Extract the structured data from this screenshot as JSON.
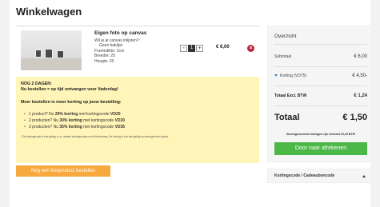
{
  "page": {
    "title": "Winkelwagen"
  },
  "cart": {
    "item": {
      "name": "Eigen foto op canvas",
      "details": [
        "Wil je je canvas inlijsten?:",
        "Geen baklijst",
        "Framedikte:   2cm",
        "Breedte:   20",
        "Hoogte:   20"
      ],
      "quantity": "1",
      "minus": "-",
      "plus": "+",
      "price": "€ 6,00",
      "remove_glyph": "×"
    },
    "promo": {
      "line1": "NOG 2 DAGEN:",
      "line2": "Nu bestellen = op tijd ontvangen voor Vaderdag!",
      "heading": "Meer bestellen is meer korting op jouw bestelling:",
      "tiers": [
        {
          "pre": "1 product? Nu ",
          "discount": "20% korting",
          "mid": " met kortingscode ",
          "code": "VD20"
        },
        {
          "pre": "2 producten? Nu ",
          "discount": "30% korting",
          "mid": " met kortingscode ",
          "code": "VD30"
        },
        {
          "pre": "3 producten? Nu ",
          "discount": "35% korting",
          "mid": " met kortingscode ",
          "code": "VD35"
        }
      ],
      "fineprint": "* De kortingscode is niet geldig i.c.m. andere kortingscodes en/of fotobehang. De korting is ook niet geldig op extra gekozen opties."
    },
    "secondary_button": "Nog een fotoproduct bestellen"
  },
  "summary": {
    "heading": "Overzicht",
    "subtotal_label": "Subtotaal",
    "subtotal_value": "€ 6,00",
    "discount_label": "Korting (VD75)",
    "discount_value": "€ 4,50-",
    "excl_label": "Totaal Excl. BTW",
    "excl_value": "€ 1,24",
    "total_label": "Totaal",
    "total_value": "€ 1,50",
    "shipping_note": "Bovengenoemde bedragen zijn inclusief €0,26 BTW",
    "checkout_button": "Door naar afrekenen",
    "coupon_label": "Kortingscode / Cadeauboncode"
  },
  "colors": {
    "promo_bg": "#fff5b8",
    "checkout_green": "#4cb848",
    "secondary_orange": "#f7a93e",
    "remove_red": "#b7243a",
    "discount_blue": "#3a7fc1"
  },
  "icons": {
    "remove": "close-circle-icon",
    "discount_toggle": "triangle-down-icon",
    "coupon_toggle": "caret-up-icon"
  }
}
